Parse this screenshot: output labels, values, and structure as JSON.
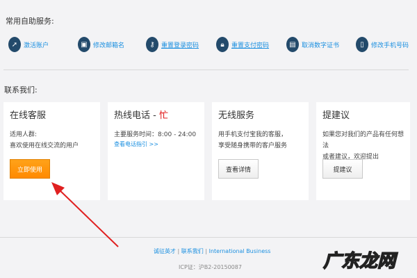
{
  "self_service": {
    "title": "常用自助服务:",
    "items": [
      {
        "label": "激活账户",
        "icon": "cursor-icon"
      },
      {
        "label": "修改邮箱名",
        "icon": "id-card-icon"
      },
      {
        "label": "重置登录密码",
        "icon": "key-icon"
      },
      {
        "label": "重置支付密码",
        "icon": "lock-icon"
      },
      {
        "label": "取消数字证书",
        "icon": "certificate-icon"
      },
      {
        "label": "修改手机号码",
        "icon": "phone-icon"
      }
    ]
  },
  "contact": {
    "title": "联系我们:",
    "cards": [
      {
        "title": "在线客服",
        "lines": [
          "适用人群:",
          "喜欢使用在线交流的用户"
        ],
        "button": "立即使用"
      },
      {
        "title": "热线电话 - ",
        "status": "忙",
        "lines": [
          "主要服务时间：8:00 - 24:00"
        ],
        "link": "查看电话指引 >>"
      },
      {
        "title": "无线服务",
        "lines": [
          "用手机支付宝我的客服，",
          "享受随身携带的客户服务"
        ],
        "button": "查看详情"
      },
      {
        "title": "提建议",
        "lines": [
          "如果您对我们的产品有任何想法",
          "或者建议，欢迎提出"
        ],
        "button": "提建议"
      }
    ]
  },
  "footer": {
    "links": [
      "诚征英才",
      "联系我们",
      "International Business"
    ],
    "sep": "|",
    "icp": "ICP证：沪B2-20150087"
  },
  "watermark": "广东龙网"
}
